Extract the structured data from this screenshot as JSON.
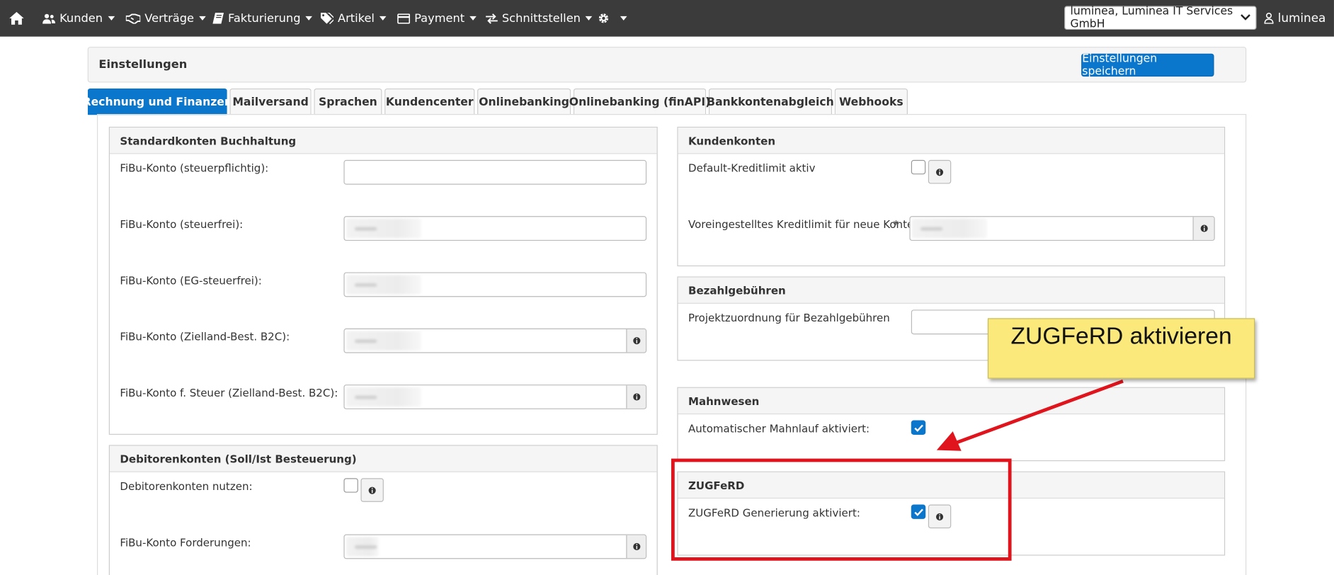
{
  "nav": {
    "items": [
      {
        "label": "Kunden",
        "icon": "users-icon"
      },
      {
        "label": "Verträge",
        "icon": "handshake-icon"
      },
      {
        "label": "Fakturierung",
        "icon": "book-icon"
      },
      {
        "label": "Artikel",
        "icon": "tags-icon"
      },
      {
        "label": "Payment",
        "icon": "credit-card-icon"
      },
      {
        "label": "Schnittstellen",
        "icon": "exchange-icon"
      }
    ],
    "company": "luminea, Luminea IT Services GmbH",
    "user": "luminea"
  },
  "header": {
    "title": "Einstellungen",
    "save_label": "Einstellungen speichern"
  },
  "tabs": [
    "Rechnung und Finanzen",
    "Mailversand",
    "Sprachen",
    "Kundencenter",
    "Onlinebanking",
    "Onlinebanking (finAPI)",
    "Bankkontenabgleich",
    "Webhooks"
  ],
  "active_tab": "Rechnung und Finanzen",
  "panels": {
    "standardkonten": {
      "title": "Standardkonten Buchhaltung",
      "fields": [
        "FiBu-Konto (steuerpflichtig):",
        "FiBu-Konto (steuerfrei):",
        "FiBu-Konto (EG-steuerfrei):",
        "FiBu-Konto (Zielland-Best. B2C):",
        "FiBu-Konto f. Steuer (Zielland-Best. B2C):"
      ]
    },
    "debitoren": {
      "title": "Debitorenkonten (Soll/Ist Besteuerung)",
      "fields": [
        "Debitorenkonten nutzen:",
        "FiBu-Konto Forderungen:"
      ]
    },
    "kundenkonten": {
      "title": "Kundenkonten",
      "fields": [
        "Default-Kreditlimit aktiv",
        "Voreingestelltes Kreditlimit für neue Konten",
        "*"
      ]
    },
    "bezahl": {
      "title": "Bezahlgebühren",
      "fields": [
        "Projektzuordnung für Bezahlgebühren"
      ]
    },
    "mahnwesen": {
      "title": "Mahnwesen",
      "fields": [
        "Automatischer Mahnlauf aktiviert:"
      ],
      "checked": true
    },
    "zugferd": {
      "title": "ZUGFeRD",
      "fields": [
        "ZUGFeRD Generierung aktiviert:"
      ],
      "checked": true
    }
  },
  "annotation": {
    "callout": "ZUGFeRD aktivieren",
    "color": "#e0141c",
    "note_color": "#fbea7b"
  },
  "colors": {
    "navbar": "#3b3b3b",
    "primary": "#0a76cc"
  }
}
